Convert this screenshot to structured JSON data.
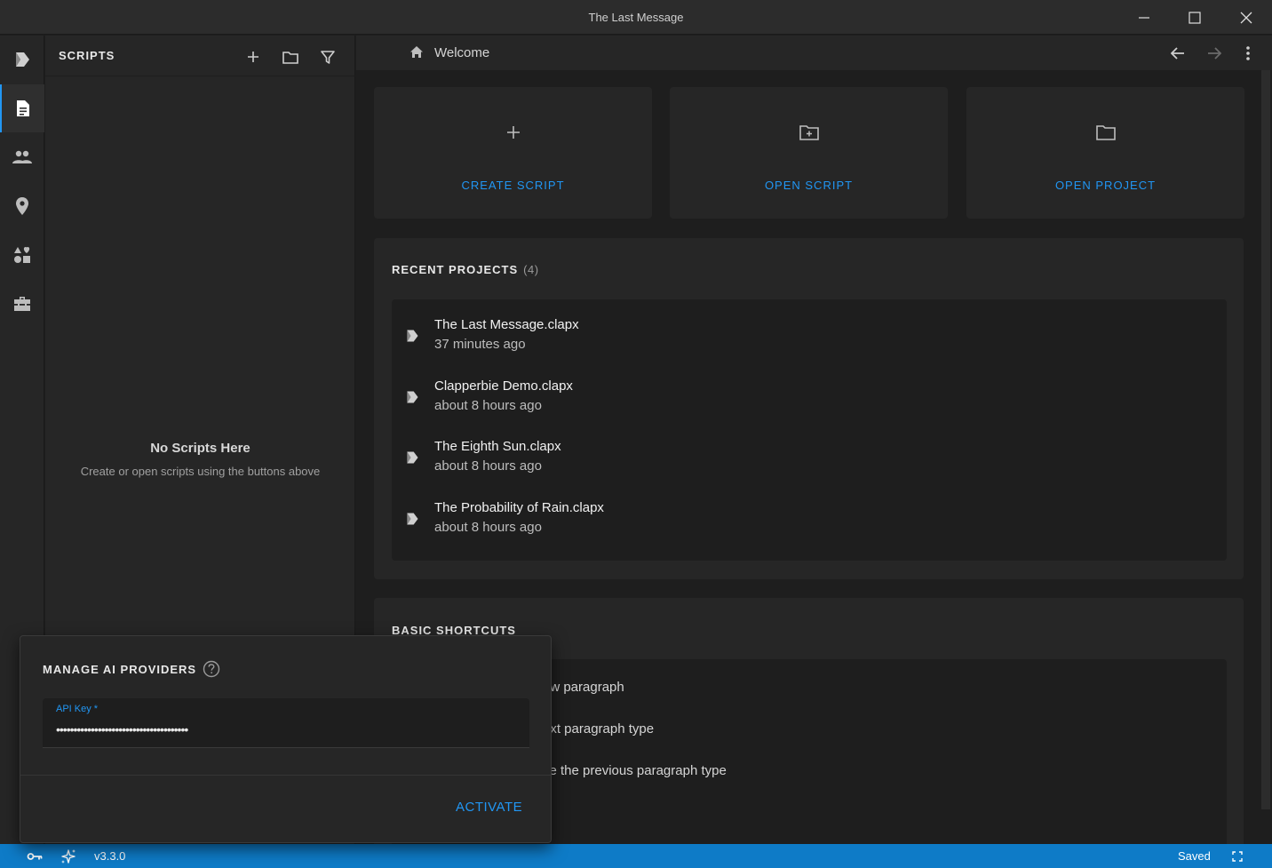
{
  "window": {
    "title": "The Last Message",
    "controls": [
      "minimize-icon",
      "maximize-icon",
      "close-icon"
    ]
  },
  "activity_bar": {
    "items": [
      {
        "name": "logo",
        "icon": "app-logo-icon"
      },
      {
        "name": "scripts",
        "icon": "document-icon",
        "active": true
      },
      {
        "name": "characters",
        "icon": "people-icon"
      },
      {
        "name": "locations",
        "icon": "location-pin-icon"
      },
      {
        "name": "elements",
        "icon": "shapes-icon"
      },
      {
        "name": "tools",
        "icon": "toolbox-icon"
      }
    ]
  },
  "sidebar": {
    "title": "SCRIPTS",
    "actions": [
      "add-icon",
      "folder-icon",
      "filter-icon"
    ],
    "empty_title": "No Scripts Here",
    "empty_subtitle": "Create or open scripts using the buttons above"
  },
  "tabbar": {
    "breadcrumb": "Welcome"
  },
  "welcome": {
    "actions": [
      {
        "label": "CREATE SCRIPT",
        "icon": "plus-icon"
      },
      {
        "label": "OPEN SCRIPT",
        "icon": "folder-plus-icon"
      },
      {
        "label": "OPEN PROJECT",
        "icon": "folder-icon"
      }
    ],
    "recent_title": "RECENT PROJECTS",
    "recent_count": "(4)",
    "recent_projects": [
      {
        "name": "The Last Message.clapx",
        "time": "37 minutes ago"
      },
      {
        "name": "Clapperbie Demo.clapx",
        "time": "about 8 hours ago"
      },
      {
        "name": "The Eighth Sun.clapx",
        "time": "about 8 hours ago"
      },
      {
        "name": "The Probability of Rain.clapx",
        "time": "about 8 hours ago"
      }
    ],
    "shortcuts_title": "BASIC SHORTCUTS",
    "shortcuts": [
      "ew paragraph",
      "ext paragraph type",
      "se the previous paragraph type"
    ]
  },
  "popup": {
    "title": "MANAGE AI PROVIDERS",
    "field_label": "API Key *",
    "field_value": "••••••••••••••••••••••••••••••••••••••",
    "activate_label": "ACTIVATE"
  },
  "statusbar": {
    "version": "v3.3.0",
    "saved": "Saved"
  },
  "colors": {
    "accent": "#2196f3",
    "statusbar": "#0e7bc7"
  }
}
